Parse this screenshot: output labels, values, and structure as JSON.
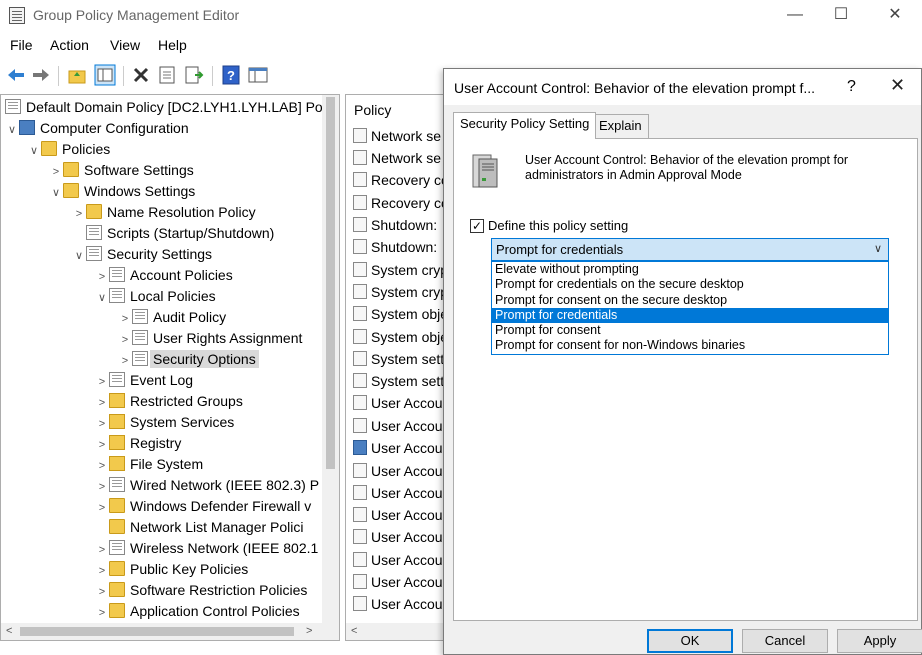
{
  "window": {
    "title": "Group Policy Management Editor",
    "controls": {
      "minimize": "—",
      "maximize": "☐",
      "close": "✕"
    }
  },
  "menu": [
    "File",
    "Action",
    "View",
    "Help"
  ],
  "toolbar_icons": [
    "back-icon",
    "forward-icon",
    "up-folder-icon",
    "show-hide-tree-icon",
    "delete-icon",
    "properties-icon",
    "export-icon",
    "help-icon",
    "console-icon"
  ],
  "tree": {
    "root": "Default Domain Policy [DC2.LYH1.LYH.LAB] Po",
    "items": [
      "Computer Configuration",
      "Policies",
      "Software Settings",
      "Windows Settings",
      "Name Resolution Policy",
      "Scripts (Startup/Shutdown)",
      "Security Settings",
      "Account Policies",
      "Local Policies",
      "Audit Policy",
      "User Rights Assignment",
      "Security Options",
      "Event Log",
      "Restricted Groups",
      "System Services",
      "Registry",
      "File System",
      "Wired Network (IEEE 802.3) P",
      "Windows Defender Firewall v",
      "Network List Manager Polici",
      "Wireless Network (IEEE 802.1",
      "Public Key Policies",
      "Software Restriction Policies",
      "Application Control Policies"
    ]
  },
  "policy_list": {
    "header": "Policy",
    "rows": [
      "Network se",
      "Network se",
      "Recovery co",
      "Recovery co",
      "Shutdown:",
      "Shutdown:",
      "System cryp",
      "System cryp",
      "System obje",
      "System obje",
      "System sett",
      "System sett",
      "User Accou",
      "User Accou",
      "User Accou",
      "User Accou",
      "User Accou",
      "User Accou",
      "User Accou",
      "User Accou",
      "User Accou",
      "User Accou"
    ]
  },
  "dialog": {
    "title": "User Account Control: Behavior of the elevation prompt f...",
    "help": "?",
    "close": "✕",
    "tabs": [
      "Security Policy Setting",
      "Explain"
    ],
    "description": "User Account Control: Behavior of the elevation prompt for administrators in Admin Approval Mode",
    "checkbox_label": "Define this policy setting",
    "checkbox_mark": "✓",
    "selected_value": "Prompt for credentials",
    "options": [
      "Elevate without prompting",
      "Prompt for credentials on the secure desktop",
      "Prompt for consent on the secure desktop",
      "Prompt for credentials",
      "Prompt for consent",
      "Prompt for consent for non-Windows binaries"
    ],
    "buttons": {
      "ok": "OK",
      "cancel": "Cancel",
      "apply": "Apply"
    }
  },
  "colors": {
    "accent": "#0078d7",
    "selection_bg": "#cce4f7",
    "tree_selected": "#d9d9d9"
  }
}
